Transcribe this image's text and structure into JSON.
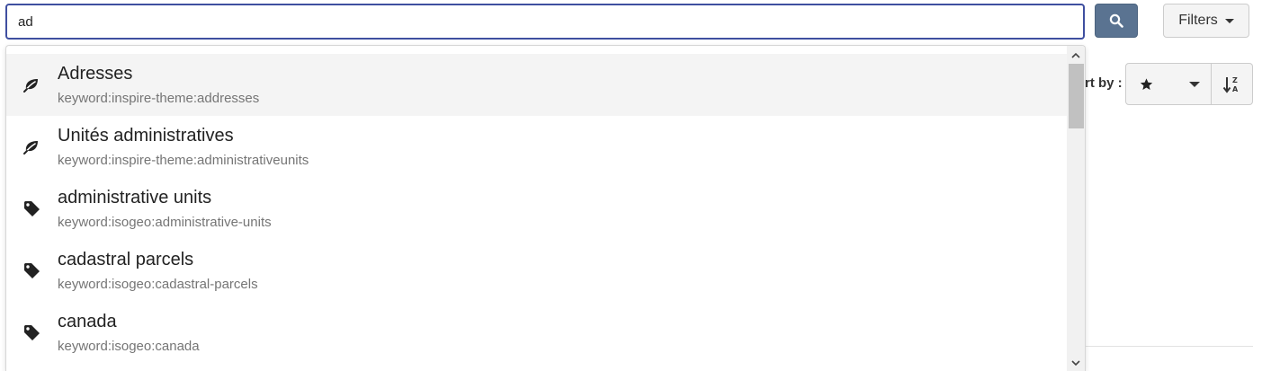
{
  "search": {
    "value": "ad",
    "placeholder": ""
  },
  "filters": {
    "label": "Filters"
  },
  "sort": {
    "label": "rt by :"
  },
  "suggestions": [
    {
      "icon": "leaf-icon",
      "title": "Adresses",
      "subtitle": "keyword:inspire-theme:addresses"
    },
    {
      "icon": "leaf-icon",
      "title": "Unités administratives",
      "subtitle": "keyword:inspire-theme:administrativeunits"
    },
    {
      "icon": "tag-icon",
      "title": "administrative units",
      "subtitle": "keyword:isogeo:administrative-units"
    },
    {
      "icon": "tag-icon",
      "title": "cadastral parcels",
      "subtitle": "keyword:isogeo:cadastral-parcels"
    },
    {
      "icon": "tag-icon",
      "title": "canada",
      "subtitle": "keyword:isogeo:canada"
    }
  ],
  "icons": {
    "search_button": "search-icon",
    "sort_field": "star-icon",
    "sort_order": "sort-alpha-desc-icon"
  },
  "colors": {
    "input_border": "#3f4fa0",
    "search_button_bg": "#5a7391",
    "active_item_bg": "#f4f4f4",
    "subtitle_text": "#757575"
  }
}
